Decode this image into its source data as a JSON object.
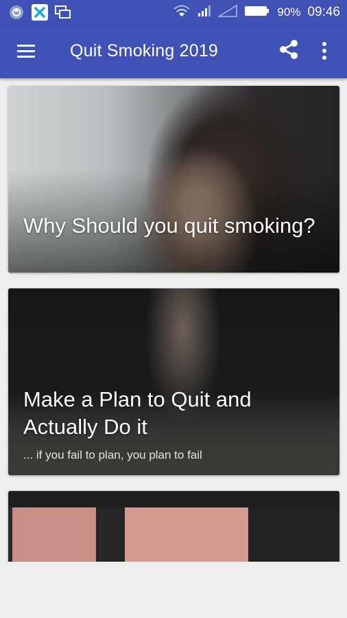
{
  "status_bar": {
    "battery": "90%",
    "time": "09:46",
    "left_icons": [
      "notification-icon",
      "app-notification-icon",
      "multiwindow-icon"
    ],
    "right_icons": [
      "wifi-icon",
      "signal-icon",
      "signal-empty-icon",
      "battery-icon"
    ]
  },
  "app_bar": {
    "title": "Quit Smoking 2019",
    "color": "#3f51b5",
    "icons": [
      "menu-icon",
      "share-icon",
      "more-vert-icon"
    ]
  },
  "cards": [
    {
      "title": "Why Should you quit smoking?",
      "subtitle": ""
    },
    {
      "title": "Make a Plan to Quit and Actually Do it",
      "subtitle": "... if you fail to plan, you plan to fail"
    },
    {
      "title": "",
      "subtitle": ""
    }
  ]
}
